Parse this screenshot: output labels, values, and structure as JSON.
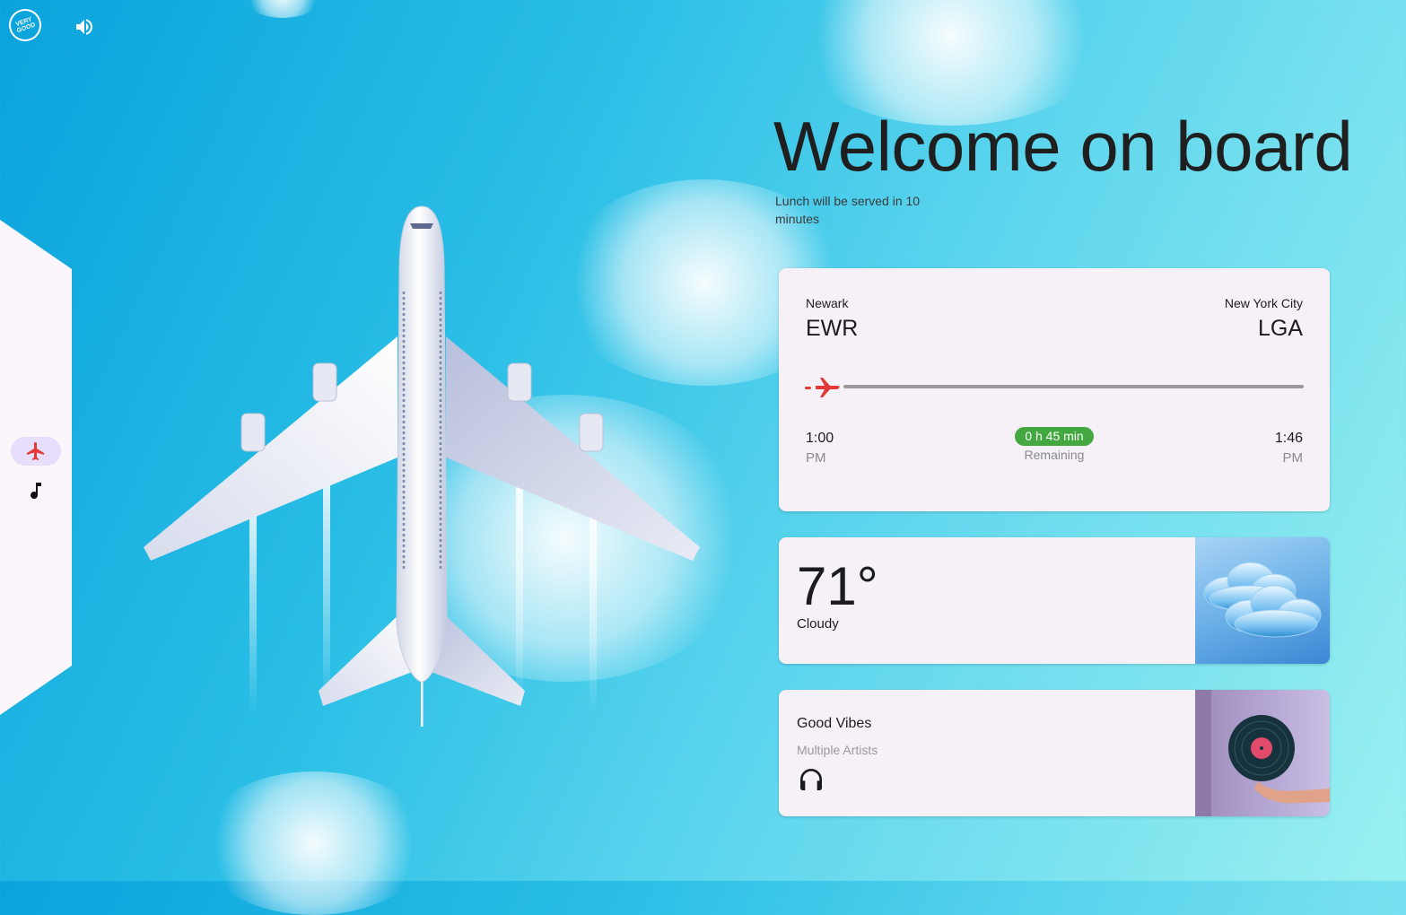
{
  "brand": {
    "logo_text": "VERY GOOD"
  },
  "header": {
    "sound_icon": "volume-up-icon"
  },
  "nav": {
    "items": [
      {
        "name": "flight",
        "icon": "airplane-icon",
        "active": true
      },
      {
        "name": "music",
        "icon": "music-note-icon",
        "active": false
      }
    ]
  },
  "welcome": {
    "title": "Welcome on board",
    "subtitle": "Lunch will be served in 10 minutes"
  },
  "flight": {
    "origin_city": "Newark",
    "origin_code": "EWR",
    "dest_city": "New York City",
    "dest_code": "LGA",
    "depart_time": "1:00",
    "depart_ampm": "PM",
    "arrive_time": "1:46",
    "arrive_ampm": "PM",
    "duration": "0 h 45 min",
    "remaining_label": "Remaining",
    "progress": 0.0
  },
  "weather": {
    "temperature": "71°",
    "condition": "Cloudy"
  },
  "music": {
    "title": "Good Vibes",
    "artist": "Multiple Artists",
    "icon": "headphones-icon"
  },
  "colors": {
    "accent_red": "#e53935",
    "nav_active_bg": "#e6defa",
    "pill_green": "#43a83f",
    "card_bg": "#f5f1f7"
  }
}
